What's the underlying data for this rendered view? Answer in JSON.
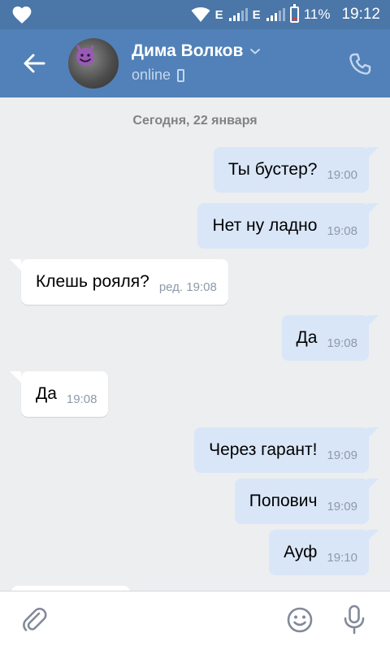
{
  "status_bar": {
    "network_1": "E",
    "network_2": "E",
    "battery": "11%",
    "time": "19:12"
  },
  "header": {
    "contact_name": "Дима Волков",
    "status": "online"
  },
  "chat": {
    "date_separator": "Сегодня, 22 января",
    "messages": [
      {
        "direction": "out",
        "text": "Ты бустер?",
        "meta": "19:00"
      },
      {
        "direction": "out",
        "text": "Нет ну ладно",
        "meta": "19:08"
      },
      {
        "direction": "in",
        "text": "Клешь рояля?",
        "meta": "ред. 19:08"
      },
      {
        "direction": "out",
        "text": "Да",
        "meta": "19:08"
      },
      {
        "direction": "in",
        "text": "Да",
        "meta": "19:08"
      },
      {
        "direction": "out",
        "text": "Через гарант!",
        "meta": "19:09"
      },
      {
        "direction": "out",
        "text": "Попович",
        "meta": "19:09"
      },
      {
        "direction": "out",
        "text": "Ауф",
        "meta": "19:10"
      }
    ]
  },
  "colors": {
    "header_bg": "#5181b8",
    "statusbar_bg": "#4a76a8",
    "chat_bg": "#edeef0",
    "outgoing_bubble": "#d9e6f7",
    "incoming_bubble": "#ffffff",
    "battery_low": "#e53935"
  },
  "icons": {
    "statusbar": [
      "heart-icon",
      "wifi-icon",
      "signal-icon",
      "battery-icon"
    ],
    "header": [
      "back-arrow-icon",
      "chevron-down-icon",
      "mobile-phone-icon",
      "call-icon"
    ],
    "inputbar": [
      "paperclip-icon",
      "smile-icon",
      "microphone-icon"
    ]
  }
}
